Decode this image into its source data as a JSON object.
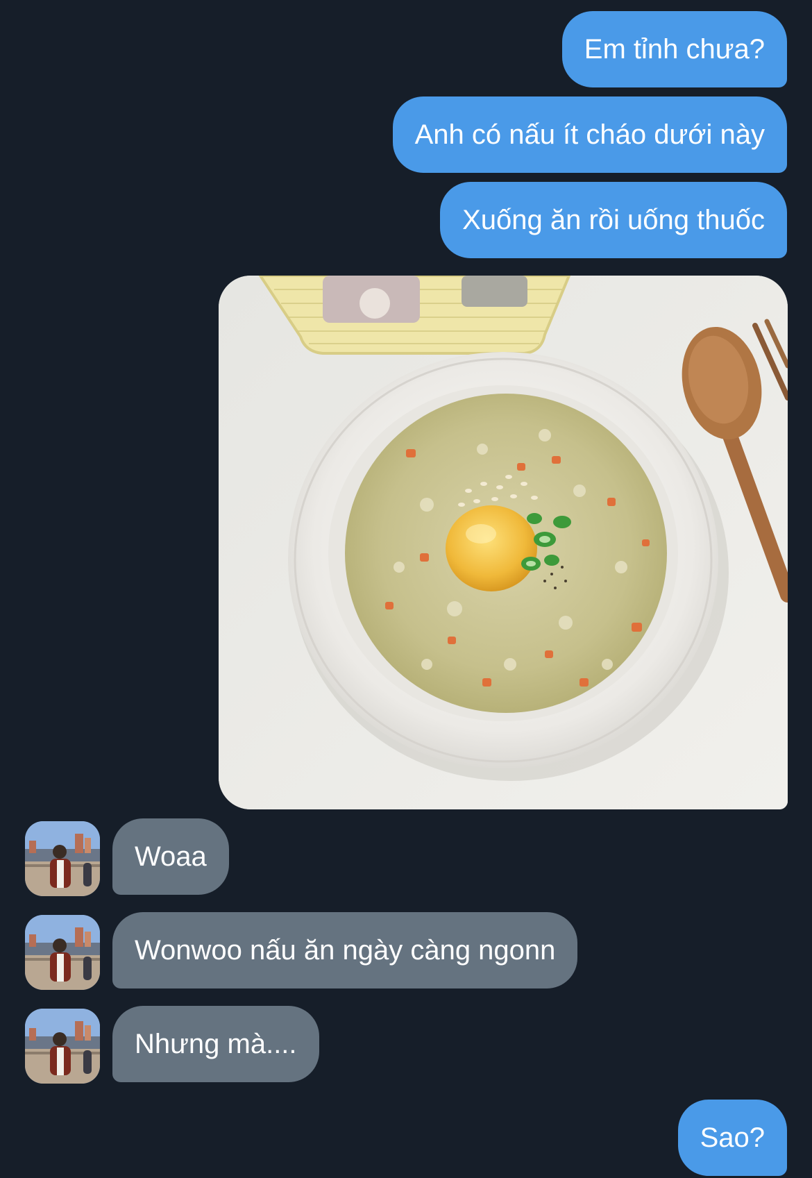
{
  "conversation": {
    "outgoing_top": [
      {
        "text": "Em tỉnh chưa?"
      },
      {
        "text": "Anh có nấu ít cháo dưới này"
      },
      {
        "text": "Xuống ăn rồi uống thuốc"
      }
    ],
    "photo": {
      "subject": "bowl-of-rice-porridge-with-egg-yolk"
    },
    "incoming": [
      {
        "text": "Woaa"
      },
      {
        "text": "Wonwoo nấu ăn ngày càng ngonn"
      },
      {
        "text": "Nhưng mà...."
      }
    ],
    "outgoing_bottom": [
      {
        "text": "Sao?"
      }
    ]
  },
  "colors": {
    "background": "#161e29",
    "outgoing_bubble": "#4a9ae8",
    "incoming_bubble": "#657380",
    "text": "#ffffff"
  }
}
